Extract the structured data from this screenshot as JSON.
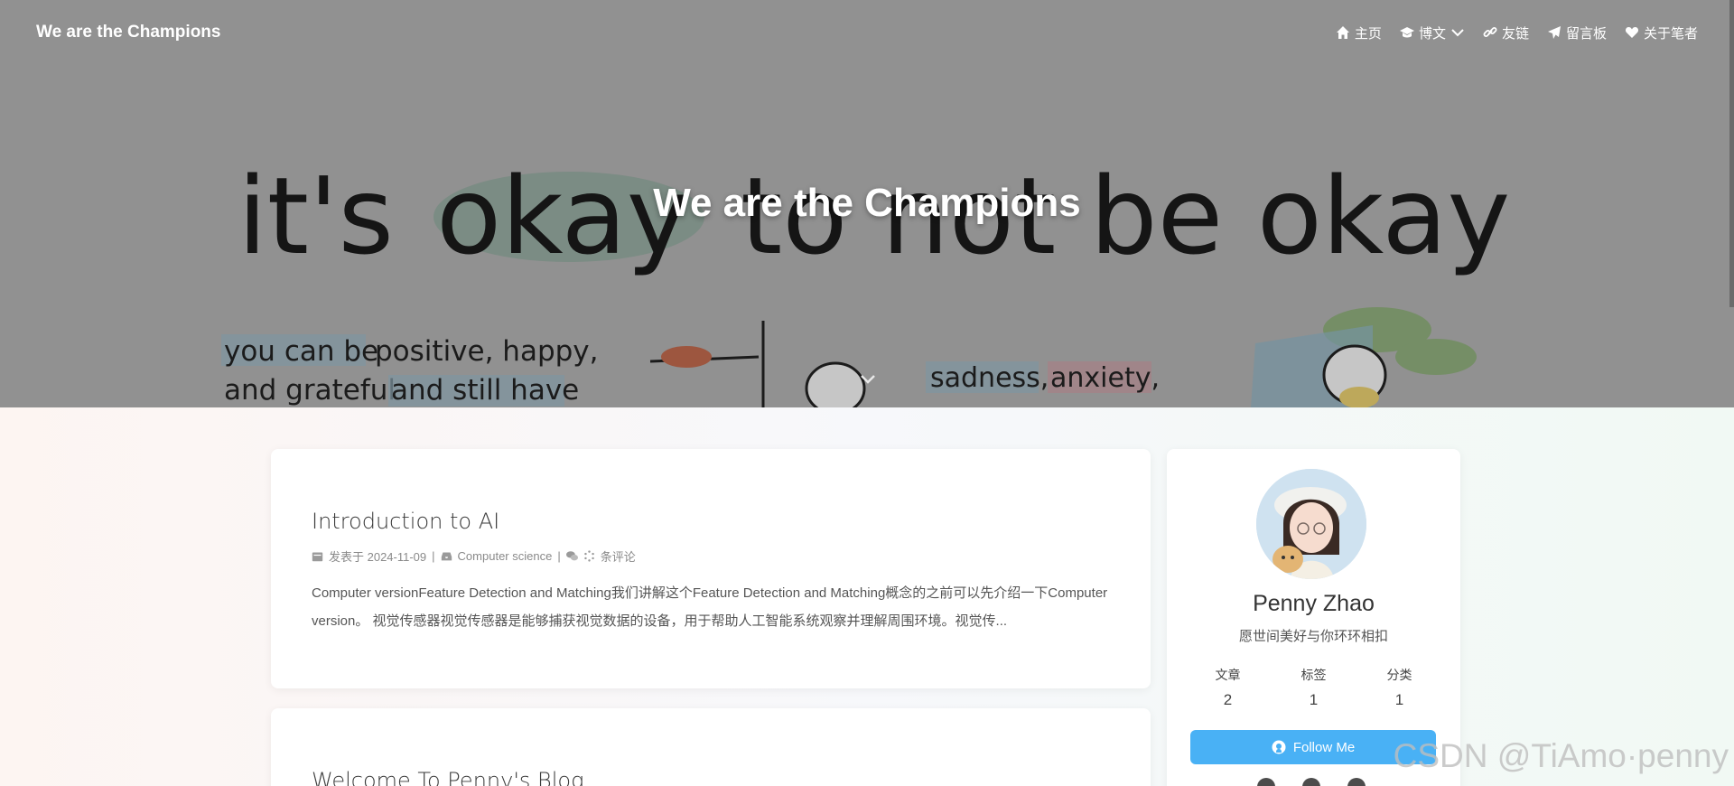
{
  "nav": {
    "brand": "We are the Champions",
    "items": [
      {
        "label": "主页",
        "icon": "home-icon"
      },
      {
        "label": "博文",
        "icon": "graduation-cap-icon",
        "dropdown": true
      },
      {
        "label": "友链",
        "icon": "link-icon"
      },
      {
        "label": "留言板",
        "icon": "paper-plane-icon"
      },
      {
        "label": "关于笔者",
        "icon": "heart-icon"
      }
    ]
  },
  "hero": {
    "title": "We are the Champions",
    "art_text": {
      "line1_parts": [
        "it's",
        "okay",
        "to not be okay"
      ],
      "line2a": "you can be",
      "line2b": "positive, happy,",
      "line3a": "and grateful",
      "line3b": "and still have",
      "right_a": "sadness,",
      "right_b": "anxiety,"
    }
  },
  "posts": [
    {
      "title": "Introduction to AI",
      "meta": {
        "date_label": "发表于 2024-11-09",
        "separator": "|",
        "category": "Computer science",
        "comments_label": "条评论"
      },
      "excerpt": "Computer versionFeature Detection and Matching我们讲解这个Feature Detection and Matching概念的之前可以先介绍一下Computer version。 视觉传感器视觉传感器是能够捕获视觉数据的设备，用于帮助人工智能系统观察并理解周围环境。视觉传..."
    },
    {
      "title": "Welcome To Penny's Blog"
    }
  ],
  "profile": {
    "name": "Penny Zhao",
    "motto": "愿世间美好与你环环相扣",
    "stats": [
      {
        "label": "文章",
        "value": "2"
      },
      {
        "label": "标签",
        "value": "1"
      },
      {
        "label": "分类",
        "value": "1"
      }
    ],
    "follow_label": "Follow Me"
  },
  "watermark": "CSDN @TiAmo·penny",
  "colors": {
    "accent": "#49b1f5",
    "hero_bg": "#b1b1b1"
  }
}
